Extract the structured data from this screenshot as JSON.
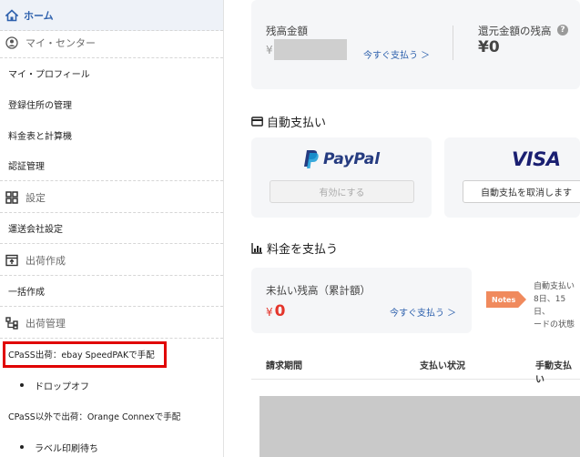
{
  "sidebar": {
    "home": "ホーム",
    "mypage_section": "マイ・センター",
    "my_profile": "マイ・プロフィール",
    "address_mgmt": "登録住所の管理",
    "rates_calc": "料金表と計算機",
    "auth_mgmt": "認証管理",
    "settings_section": "設定",
    "carrier_settings": "運送会社設定",
    "shipment_create_section": "出荷作成",
    "bulk_create": "一括作成",
    "shipment_mgmt_section": "出荷管理",
    "cpass_ebay": "CPaSS出荷：ebay SpeedPAKで手配",
    "dropoff": "ドロップオフ",
    "non_cpass": "CPaSS以外で出荷：Orange Connexで手配",
    "label_print_wait": "ラベル印刷待ち"
  },
  "balance": {
    "label": "残高金額",
    "currency": "¥",
    "pay_now": "今すぐ支払う ＞",
    "refund_label": "還元金額の残高",
    "refund_value": "¥0",
    "help": "?"
  },
  "auto_pay": {
    "title": "自動支払い",
    "paypal_logo": "PayPal",
    "paypal_button": "有効にする",
    "visa_logo": "VISA",
    "visa_button": "自動支払を取消します"
  },
  "pay_fees": {
    "title": "料金を支払う",
    "unpaid_label": "未払い残高（累計額）",
    "unpaid_currency": "¥",
    "unpaid_value": "0",
    "pay_now": "今すぐ支払う ＞",
    "notes_badge": "Notes",
    "notes_line1": "自動支払い",
    "notes_line2": "8日、15日、",
    "notes_line3": "ードの状態"
  },
  "table": {
    "col_period": "請求期間",
    "col_status": "支払い状況",
    "col_method": "手動支払い"
  },
  "colors": {
    "accent": "#2e61ad",
    "red": "#e4352b",
    "notes_orange": "#f08a5d",
    "highlight_red": "#e00000"
  }
}
